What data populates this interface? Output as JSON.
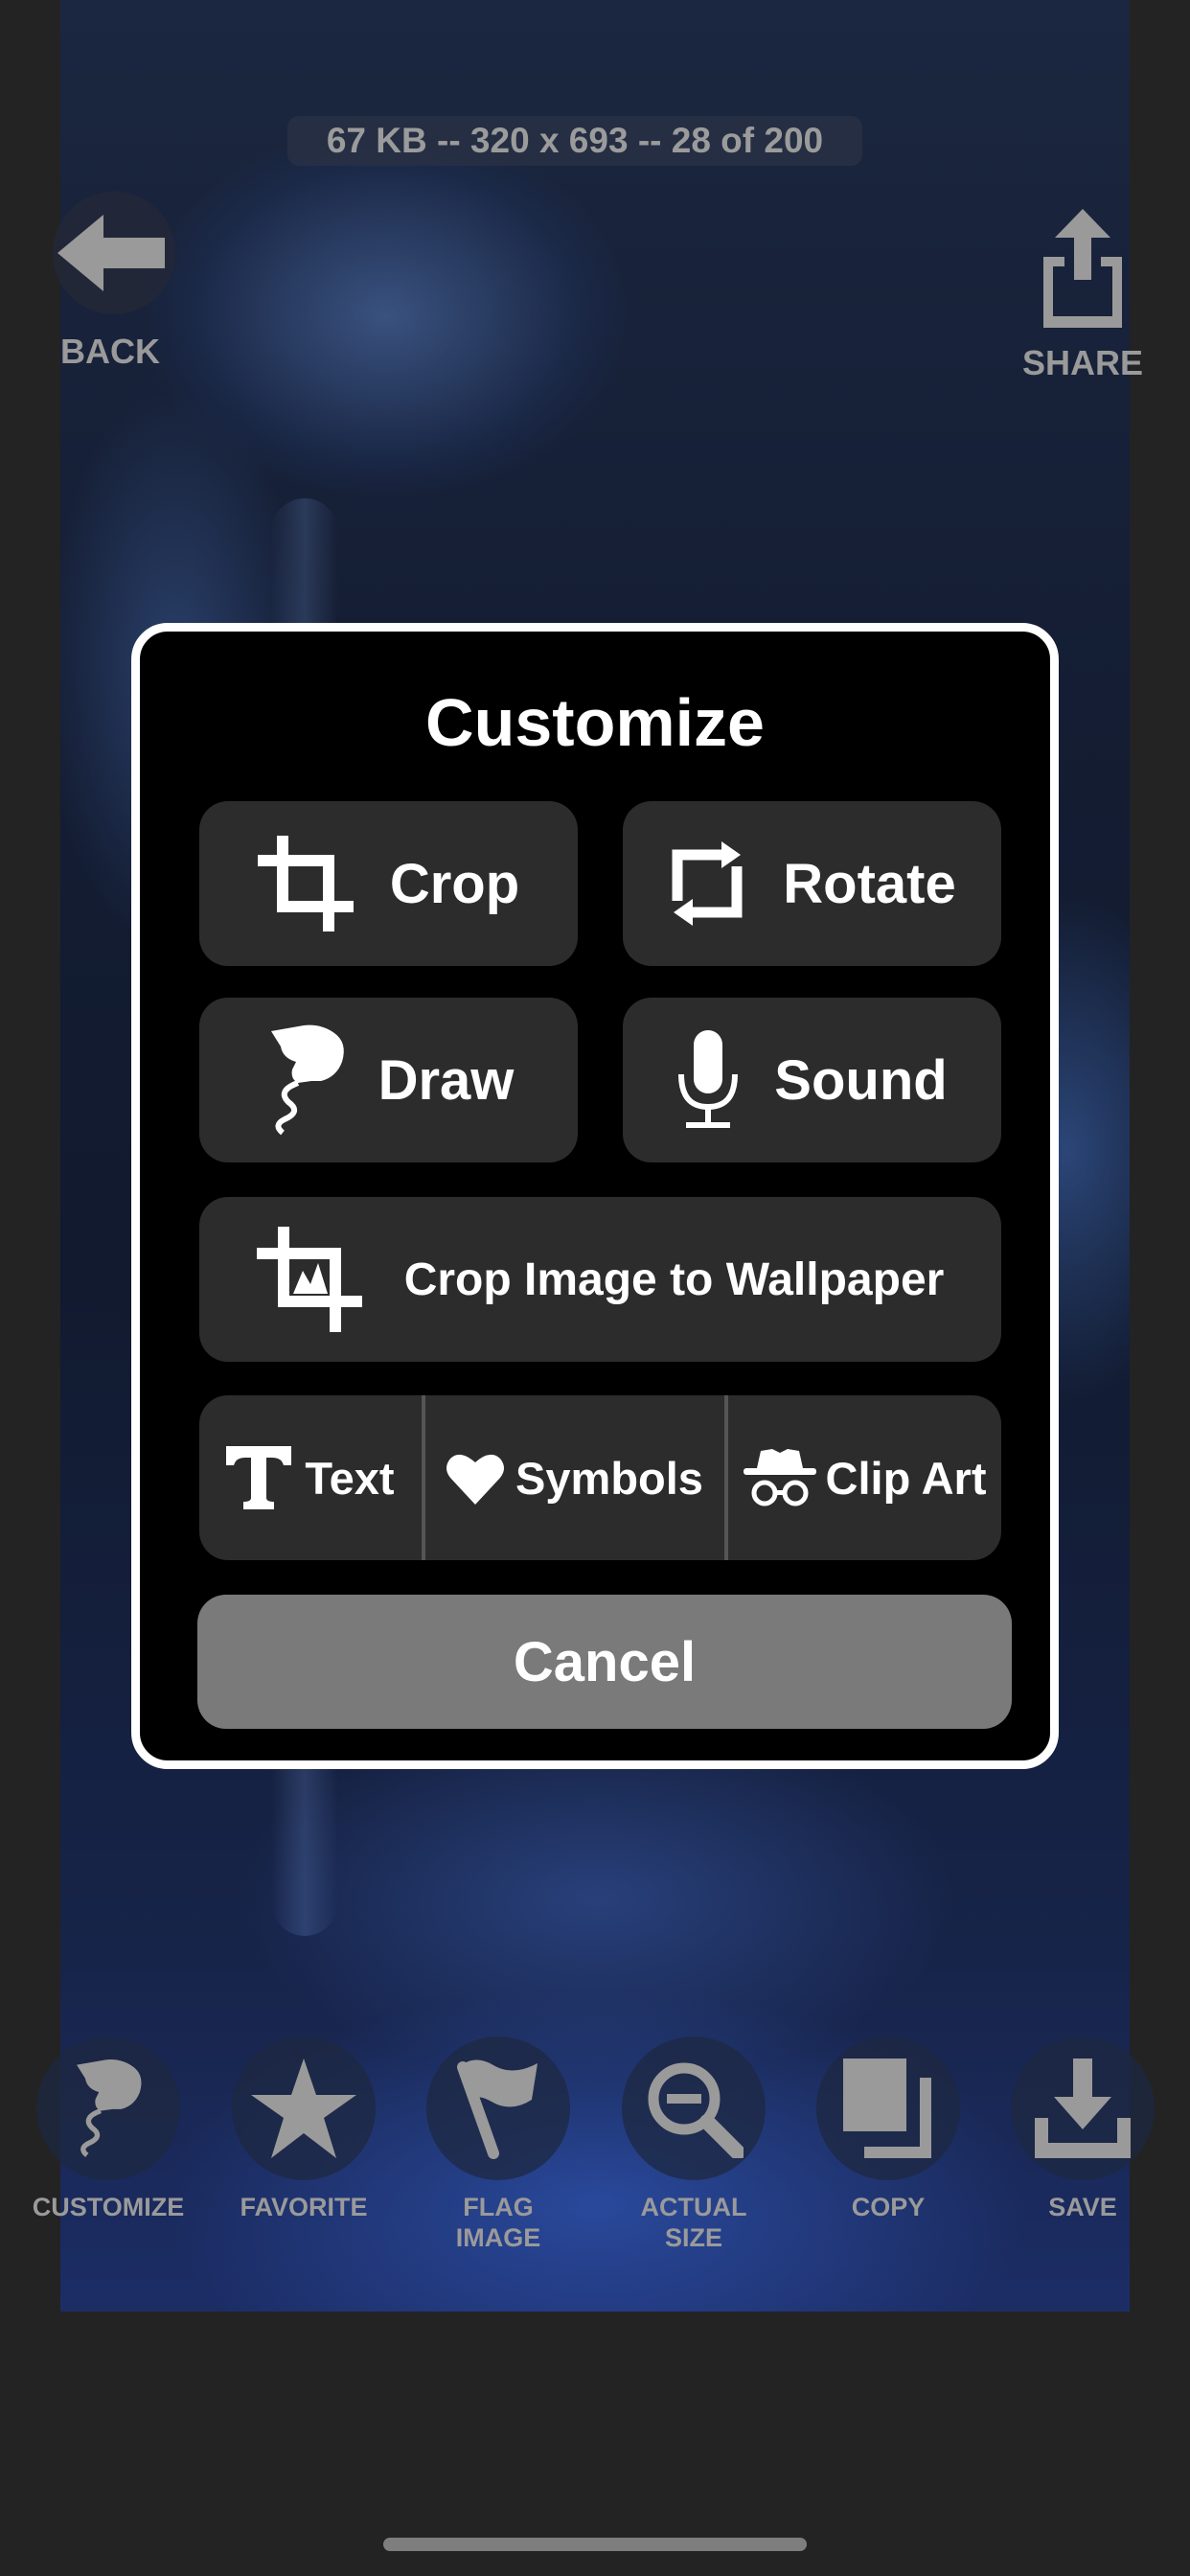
{
  "header": {
    "image_info": "67 KB -- 320 x 693 -- 28 of 200",
    "back_label": "BACK",
    "share_label": "SHARE"
  },
  "modal": {
    "title": "Customize",
    "crop_label": "Crop",
    "rotate_label": "Rotate",
    "draw_label": "Draw",
    "sound_label": "Sound",
    "crop_wallpaper_label": "Crop Image to Wallpaper",
    "text_label": "Text",
    "symbols_label": "Symbols",
    "clipart_label": "Clip Art",
    "cancel_label": "Cancel"
  },
  "toolbar": {
    "customize_label": "CUSTOMIZE",
    "favorite_label": "FAVORITE",
    "flag_line1": "FLAG",
    "flag_line2": "IMAGE",
    "actual_line1": "ACTUAL",
    "actual_line2": "SIZE",
    "copy_label": "COPY",
    "save_label": "SAVE"
  },
  "icons": {
    "back": "arrow-left-icon",
    "share": "share-icon",
    "crop": "crop-icon",
    "rotate": "rotate-icon",
    "draw": "draw-hand-icon",
    "sound": "microphone-icon",
    "crop_wallpaper": "crop-wallpaper-icon",
    "text": "text-t-icon",
    "symbols": "heart-icon",
    "clipart": "spy-icon",
    "customize": "draw-hand-icon",
    "favorite": "star-icon",
    "flag": "flag-icon",
    "actual_size": "zoom-out-icon",
    "copy": "copy-icon",
    "save": "download-icon"
  },
  "colors": {
    "background": "#232323",
    "modal_background": "#000000",
    "modal_border": "#ffffff",
    "option_button": "#2c2c2c",
    "cancel_button": "#7a7a7a",
    "toolbar_text": "#9a9a9a"
  }
}
